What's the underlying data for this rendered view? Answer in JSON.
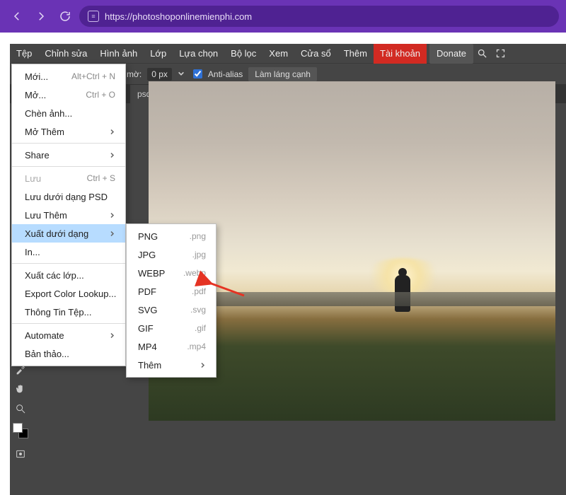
{
  "browser": {
    "url": "https://photoshoponlinemienphi.com"
  },
  "menubar": {
    "items": [
      "Tệp",
      "Chỉnh sửa",
      "Hình ảnh",
      "Lớp",
      "Lựa chọn",
      "Bộ lọc",
      "Xem",
      "Cửa sổ",
      "Thêm"
    ],
    "account": "Tài khoản",
    "donate": "Donate"
  },
  "optbar": {
    "feather_label": "mờ:",
    "feather_value": "0 px",
    "antialias": "Anti-alias",
    "refine": "Làm láng cạnh"
  },
  "tabs": {
    "active": "psd *"
  },
  "file_menu": [
    {
      "label": "Mới...",
      "shortcut": "Alt+Ctrl + N"
    },
    {
      "label": "Mở...",
      "shortcut": "Ctrl + O"
    },
    {
      "label": "Chèn ảnh..."
    },
    {
      "label": "Mở Thêm",
      "sub": true
    },
    {
      "sep": true
    },
    {
      "label": "Share",
      "sub": true
    },
    {
      "sep": true
    },
    {
      "label": "Lưu",
      "shortcut": "Ctrl + S",
      "disabled": true
    },
    {
      "label": "Lưu dưới dạng PSD"
    },
    {
      "label": "Lưu Thêm",
      "sub": true
    },
    {
      "label": "Xuất dưới dạng",
      "sub": true,
      "hover": true
    },
    {
      "label": "In..."
    },
    {
      "sep": true
    },
    {
      "label": "Xuất các lớp..."
    },
    {
      "label": "Export Color Lookup..."
    },
    {
      "label": "Thông Tin Tệp..."
    },
    {
      "sep": true
    },
    {
      "label": "Automate",
      "sub": true
    },
    {
      "label": "Bản thảo..."
    }
  ],
  "export_menu": [
    {
      "label": "PNG",
      "ext": ".png"
    },
    {
      "label": "JPG",
      "ext": ".jpg"
    },
    {
      "label": "WEBP",
      "ext": ".webp"
    },
    {
      "label": "PDF",
      "ext": ".pdf"
    },
    {
      "label": "SVG",
      "ext": ".svg"
    },
    {
      "label": "GIF",
      "ext": ".gif"
    },
    {
      "label": "MP4",
      "ext": ".mp4"
    },
    {
      "label": "Thêm",
      "sub": true
    }
  ]
}
